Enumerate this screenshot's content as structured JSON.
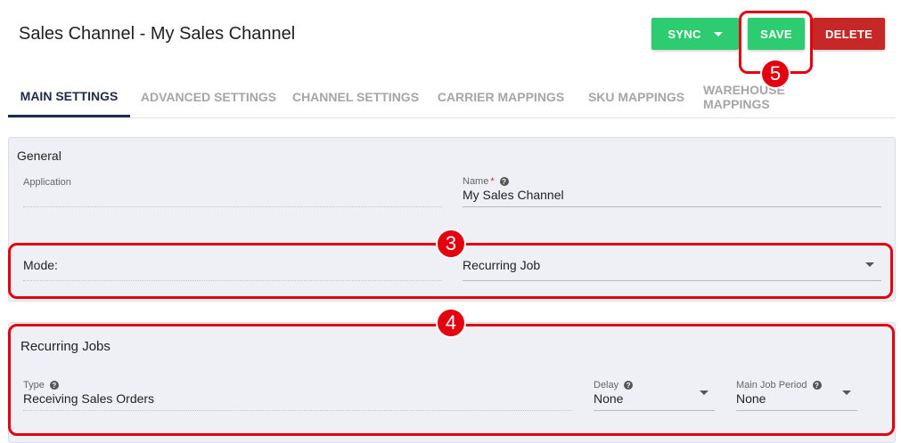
{
  "header": {
    "title": "Sales Channel - My Sales Channel",
    "sync_label": "SYNC",
    "save_label": "SAVE",
    "delete_label": "DELETE"
  },
  "tabs": [
    {
      "label": "MAIN SETTINGS",
      "active": true
    },
    {
      "label": "ADVANCED SETTINGS",
      "active": false
    },
    {
      "label": "CHANNEL SETTINGS",
      "active": false
    },
    {
      "label": "CARRIER MAPPINGS",
      "active": false
    },
    {
      "label": "SKU MAPPINGS",
      "active": false
    },
    {
      "label": "WAREHOUSE MAPPINGS",
      "active": false
    }
  ],
  "general": {
    "title": "General",
    "application_label": "Application",
    "application_value": "",
    "name_label": "Name",
    "name_required": "*",
    "name_value": "My  Sales Channel",
    "mode_label": "Mode:",
    "mode_value": "Recurring Job"
  },
  "recurring": {
    "title": "Recurring Jobs",
    "type_label": "Type",
    "type_value": "Receiving Sales Orders",
    "delay_label": "Delay",
    "delay_value": "None",
    "period_label": "Main Job Period",
    "period_value": "None"
  },
  "annotations": {
    "badge_3": "3",
    "badge_4": "4",
    "badge_5": "5",
    "highlight_color": "#e3000f"
  },
  "colors": {
    "sync": "#2ecc71",
    "save": "#2ecc71",
    "delete": "#c62828",
    "active_tab": "#1f2a44"
  }
}
